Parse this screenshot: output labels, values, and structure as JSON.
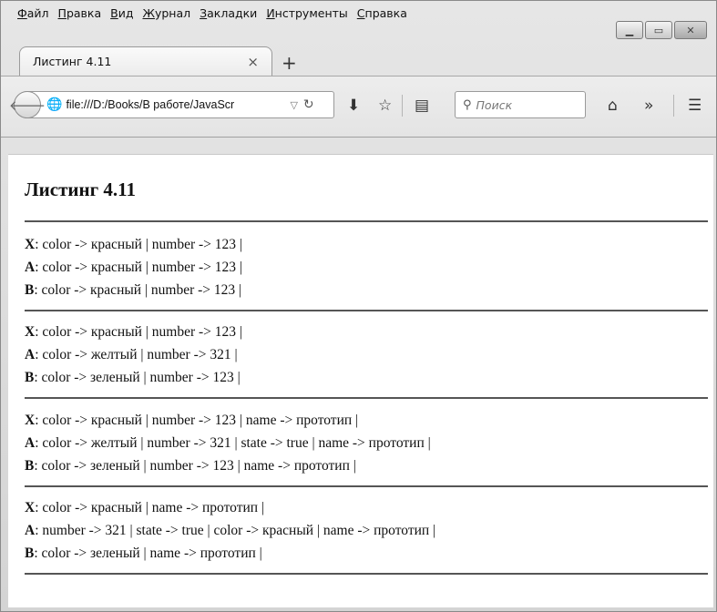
{
  "menu": [
    {
      "acc": "Ф",
      "rest": "айл"
    },
    {
      "acc": "П",
      "rest": "равка"
    },
    {
      "acc": "В",
      "rest": "ид"
    },
    {
      "acc": "Ж",
      "rest": "урнал"
    },
    {
      "acc": "З",
      "rest": "акладки"
    },
    {
      "acc": "И",
      "rest": "нструменты"
    },
    {
      "acc": "С",
      "rest": "правка"
    }
  ],
  "tab": {
    "title": "Листинг 4.11",
    "close": "×",
    "new_tab": "+"
  },
  "navbar": {
    "url": "file:///D:/Books/В работе/JavaScr",
    "search_placeholder": "Поиск",
    "overflow": "»"
  },
  "page": {
    "heading": "Листинг 4.11",
    "groups": [
      [
        {
          "label": "X",
          "text": ": color -> красный | number -> 123 |"
        },
        {
          "label": "A",
          "text": ": color -> красный | number -> 123 |"
        },
        {
          "label": "B",
          "text": ": color -> красный | number -> 123 |"
        }
      ],
      [
        {
          "label": "X",
          "text": ": color -> красный | number -> 123 |"
        },
        {
          "label": "A",
          "text": ": color -> желтый | number -> 321 |"
        },
        {
          "label": "B",
          "text": ": color -> зеленый | number -> 123 |"
        }
      ],
      [
        {
          "label": "X",
          "text": ": color -> красный | number -> 123 | name -> прототип |"
        },
        {
          "label": "A",
          "text": ": color -> желтый | number -> 321 | state -> true | name -> прототип |"
        },
        {
          "label": "B",
          "text": ": color -> зеленый | number -> 123 | name -> прототип |"
        }
      ],
      [
        {
          "label": "X",
          "text": ": color -> красный | name -> прототип |"
        },
        {
          "label": "A",
          "text": ": number -> 321 | state -> true | color -> красный | name -> прототип |"
        },
        {
          "label": "B",
          "text": ": color -> зеленый | name -> прототип |"
        }
      ]
    ]
  }
}
